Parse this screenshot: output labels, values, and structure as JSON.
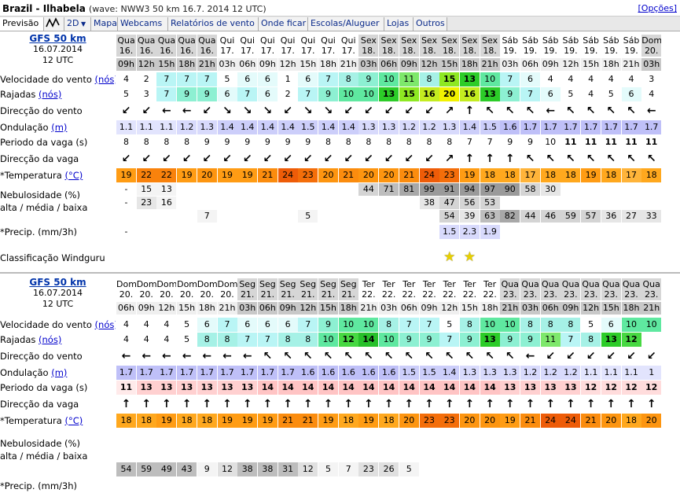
{
  "title": "Brazil - Ilhabela",
  "wave_info": "(wave: NWW3 50 km 16.7. 2014 12 UTC)",
  "options_link": "[Opções]",
  "tabs": [
    "Previsão",
    "",
    "2D",
    "Mapa",
    "Webcams",
    "Relatórios de vento",
    "Onde ficar",
    "Escolas/Aluguer",
    "Lojas",
    "Outros"
  ],
  "labels": {
    "wind": "Velocidade do vento ",
    "wind_unit": "(nós)",
    "gust": "Rajadas ",
    "gust_unit": "(nós)",
    "wdir": "Direcção do vento",
    "swell": "Ondulação ",
    "swell_unit": "(m)",
    "period": "Periodo da vaga (s)",
    "wavedir": "Direcção da vaga",
    "temp": "*Temperatura ",
    "temp_unit": "(°C)",
    "cloud": "Nebulosidade (%)",
    "cloud2": "alta / média / baixa",
    "precip": "*Precip. (mm/3h)",
    "rating": "Classificação Windguru"
  },
  "colors": {
    "cloud": "#eeeeee",
    "dark": "#999999"
  },
  "panels": [
    {
      "model": "GFS 50 km",
      "date": "16.07.2014",
      "utc": "12 UTC",
      "days": [
        "Qua",
        "Qua",
        "Qua",
        "Qua",
        "Qua",
        "Qui",
        "Qui",
        "Qui",
        "Qui",
        "Qui",
        "Qui",
        "Qui",
        "Qui",
        "Sex",
        "Sex",
        "Sex",
        "Sex",
        "Sex",
        "Sex",
        "Sex",
        "Sex",
        "Sáb",
        "Sáb",
        "Sáb",
        "Sáb",
        "Sáb",
        "Sáb",
        "Sáb",
        "Dom"
      ],
      "dates": [
        "16.",
        "16.",
        "16.",
        "16.",
        "16.",
        "17.",
        "17.",
        "17.",
        "17.",
        "17.",
        "17.",
        "17.",
        "17.",
        "18.",
        "18.",
        "18.",
        "18.",
        "18.",
        "18.",
        "18.",
        "18.",
        "19.",
        "19.",
        "19.",
        "19.",
        "19.",
        "19.",
        "19.",
        "20."
      ],
      "hours": [
        "09h",
        "12h",
        "15h",
        "18h",
        "21h",
        "03h",
        "06h",
        "09h",
        "12h",
        "15h",
        "18h",
        "21h",
        "03h",
        "06h",
        "09h",
        "12h",
        "15h",
        "18h",
        "21h",
        "03h",
        "06h",
        "09h",
        "12h",
        "15h",
        "18h",
        "21h",
        "03h"
      ],
      "dayrow": [
        "Qua",
        "Qua",
        "Qua",
        "Qua",
        "Qua",
        "Qui",
        "Qui",
        "Qui",
        "Qui",
        "Qui",
        "Qui",
        "Qui",
        "Sex",
        "Sex",
        "Sex",
        "Sex",
        "Sex",
        "Sex",
        "Sex",
        "Sáb",
        "Sáb",
        "Sáb",
        "Sáb",
        "Sáb",
        "Sáb",
        "Sáb",
        "Dom"
      ],
      "daterow": [
        "16.",
        "16.",
        "16.",
        "16.",
        "16.",
        "17.",
        "17.",
        "17.",
        "17.",
        "17.",
        "17.",
        "17.",
        "18.",
        "18.",
        "18.",
        "18.",
        "18.",
        "18.",
        "18.",
        "19.",
        "19.",
        "19.",
        "19.",
        "19.",
        "19.",
        "19.",
        "20."
      ],
      "wind": [
        "4",
        "2",
        "7",
        "7",
        "7",
        "5",
        "6",
        "6",
        "1",
        "6",
        "7",
        "8",
        "9",
        "10",
        "11",
        "8",
        "15",
        "13",
        "10",
        "7",
        "6",
        "4",
        "4",
        "4",
        "4",
        "4",
        "3"
      ],
      "gust": [
        "5",
        "3",
        "7",
        "9",
        "9",
        "6",
        "7",
        "6",
        "2",
        "7",
        "9",
        "10",
        "10",
        "13",
        "15",
        "16",
        "20",
        "16",
        "13",
        "9",
        "7",
        "6",
        "5",
        "4",
        "5",
        "6",
        "4"
      ],
      "wdir": [
        "↙",
        "↙",
        "←",
        "←",
        "↙",
        "↘",
        "↘",
        "↘",
        "↙",
        "↘",
        "↘",
        "↙",
        "↙",
        "↙",
        "↙",
        "↙",
        "↗",
        "↑",
        "↖",
        "↖",
        "↖",
        "←",
        "↖",
        "↖",
        "↖",
        "↖",
        "←"
      ],
      "swell": [
        "1.1",
        "1.1",
        "1.1",
        "1.2",
        "1.3",
        "1.4",
        "1.4",
        "1.4",
        "1.4",
        "1.5",
        "1.4",
        "1.4",
        "1.3",
        "1.3",
        "1.2",
        "1.2",
        "1.3",
        "1.4",
        "1.5",
        "1.6",
        "1.7",
        "1.7",
        "1.7",
        "1.7",
        "1.7",
        "1.7",
        "1.7"
      ],
      "period": [
        "8",
        "8",
        "8",
        "8",
        "9",
        "9",
        "9",
        "9",
        "9",
        "9",
        "8",
        "8",
        "8",
        "8",
        "8",
        "8",
        "8",
        "7",
        "7",
        "9",
        "9",
        "10",
        "11",
        "11",
        "11",
        "11",
        "11"
      ],
      "wavedir": [
        "↙",
        "↙",
        "↙",
        "↙",
        "↙",
        "↙",
        "↙",
        "↙",
        "↙",
        "↙",
        "↙",
        "↙",
        "↙",
        "↙",
        "↙",
        "↙",
        "↗",
        "↑",
        "↑",
        "↑",
        "↖",
        "↖",
        "↖",
        "↖",
        "↖",
        "↖",
        "↖"
      ],
      "temp": [
        "19",
        "22",
        "22",
        "19",
        "20",
        "19",
        "19",
        "21",
        "24",
        "23",
        "20",
        "21",
        "20",
        "20",
        "21",
        "24",
        "23",
        "19",
        "18",
        "18",
        "17",
        "18",
        "18",
        "19",
        "18",
        "17",
        "18"
      ],
      "cloud_high": [
        "-",
        "15",
        "13",
        "",
        "",
        "",
        "",
        "",
        "",
        "",
        "",
        "",
        "44",
        "71",
        "81",
        "99",
        "91",
        "94",
        "97",
        "90",
        "58",
        "30",
        "",
        "",
        "",
        "",
        ""
      ],
      "cloud_mid": [
        "-",
        "23",
        "16",
        "",
        "",
        "",
        "",
        "",
        "",
        "",
        "",
        "",
        "",
        "",
        "",
        "38",
        "47",
        "56",
        "53",
        "",
        "",
        "",
        "",
        "",
        "",
        "",
        ""
      ],
      "cloud_low": [
        "",
        "",
        "",
        "",
        "7",
        "",
        "",
        "",
        "",
        "5",
        "",
        "",
        "",
        "",
        "",
        "",
        "54",
        "39",
        "63",
        "82",
        "44",
        "46",
        "59",
        "57",
        "36",
        "27",
        "33"
      ],
      "precip": [
        "-",
        "",
        "",
        "",
        "",
        "",
        "",
        "",
        "",
        "",
        "",
        "",
        "",
        "",
        "",
        "",
        "1.5",
        "2.3",
        "1.9",
        "",
        "",
        "",
        "",
        "",
        "",
        "",
        ""
      ],
      "stars": [
        16,
        17
      ]
    },
    {
      "model": "GFS 50 km",
      "date": "16.07.2014",
      "utc": "12 UTC",
      "dayrow": [
        "Dom",
        "Dom",
        "Dom",
        "Dom",
        "Dom",
        "Dom",
        "Seg",
        "Seg",
        "Seg",
        "Seg",
        "Seg",
        "Seg",
        "Ter",
        "Ter",
        "Ter",
        "Ter",
        "Ter",
        "Ter",
        "Ter",
        "Qua",
        "Qua",
        "Qua",
        "Qua",
        "Qua",
        "Qua",
        "Qua",
        "Qua"
      ],
      "daterow": [
        "20.",
        "20.",
        "20.",
        "20.",
        "20.",
        "20.",
        "21.",
        "21.",
        "21.",
        "21.",
        "21.",
        "21.",
        "22.",
        "22.",
        "22.",
        "22.",
        "22.",
        "22.",
        "22.",
        "23.",
        "23.",
        "23.",
        "23.",
        "23.",
        "23.",
        "23.",
        "23."
      ],
      "hours": [
        "06h",
        "09h",
        "12h",
        "15h",
        "18h",
        "21h",
        "03h",
        "06h",
        "09h",
        "12h",
        "15h",
        "18h",
        "21h",
        "03h",
        "06h",
        "09h",
        "12h",
        "15h",
        "18h",
        "21h",
        "03h",
        "06h",
        "09h",
        "12h",
        "15h",
        "18h",
        "21h"
      ],
      "wind": [
        "4",
        "4",
        "4",
        "5",
        "6",
        "7",
        "6",
        "6",
        "6",
        "7",
        "9",
        "10",
        "10",
        "8",
        "7",
        "7",
        "5",
        "8",
        "10",
        "10",
        "8",
        "8",
        "8",
        "5",
        "6",
        "10",
        "10"
      ],
      "gust": [
        "4",
        "4",
        "4",
        "5",
        "8",
        "8",
        "7",
        "7",
        "8",
        "8",
        "10",
        "12",
        "14",
        "10",
        "9",
        "9",
        "7",
        "9",
        "13",
        "9",
        "9",
        "11",
        "7",
        "8",
        "13",
        "12"
      ],
      "wdir": [
        "←",
        "←",
        "←",
        "←",
        "←",
        "←",
        "←",
        "↖",
        "↖",
        "↖",
        "↖",
        "↖",
        "↖",
        "↖",
        "↖",
        "↖",
        "↖",
        "↖",
        "↖",
        "↖",
        "←",
        "↙",
        "↙",
        "↙",
        "↙",
        "↙",
        "↙"
      ],
      "swell": [
        "1.7",
        "1.7",
        "1.7",
        "1.7",
        "1.7",
        "1.7",
        "1.7",
        "1.7",
        "1.7",
        "1.6",
        "1.6",
        "1.6",
        "1.6",
        "1.6",
        "1.5",
        "1.5",
        "1.4",
        "1.3",
        "1.3",
        "1.3",
        "1.2",
        "1.2",
        "1.2",
        "1.1",
        "1.1",
        "1.1",
        "1"
      ],
      "period": [
        "11",
        "13",
        "13",
        "13",
        "13",
        "13",
        "13",
        "14",
        "14",
        "14",
        "14",
        "14",
        "14",
        "14",
        "14",
        "14",
        "14",
        "14",
        "14",
        "13",
        "13",
        "13",
        "13",
        "12",
        "12",
        "12",
        "12"
      ],
      "wavedir": [
        "↑",
        "↑",
        "↑",
        "↑",
        "↑",
        "↑",
        "↑",
        "↑",
        "↑",
        "↑",
        "↑",
        "↑",
        "↑",
        "↑",
        "↑",
        "↑",
        "↑",
        "↑",
        "↑",
        "↑",
        "↑",
        "↑",
        "↑",
        "↑",
        "↑",
        "↑",
        "↑"
      ],
      "temp": [
        "18",
        "18",
        "19",
        "18",
        "18",
        "19",
        "19",
        "19",
        "21",
        "21",
        "19",
        "18",
        "19",
        "18",
        "20",
        "23",
        "23",
        "20",
        "20",
        "19",
        "21",
        "24",
        "24",
        "21",
        "20",
        "18",
        "20"
      ],
      "cloud_low": [
        "54",
        "59",
        "49",
        "43",
        "9",
        "12",
        "38",
        "38",
        "31",
        "12",
        "5",
        "7",
        "23",
        "26",
        "5",
        "",
        "",
        "",
        "",
        "",
        "",
        "",
        "",
        "",
        "",
        "",
        ""
      ]
    }
  ]
}
